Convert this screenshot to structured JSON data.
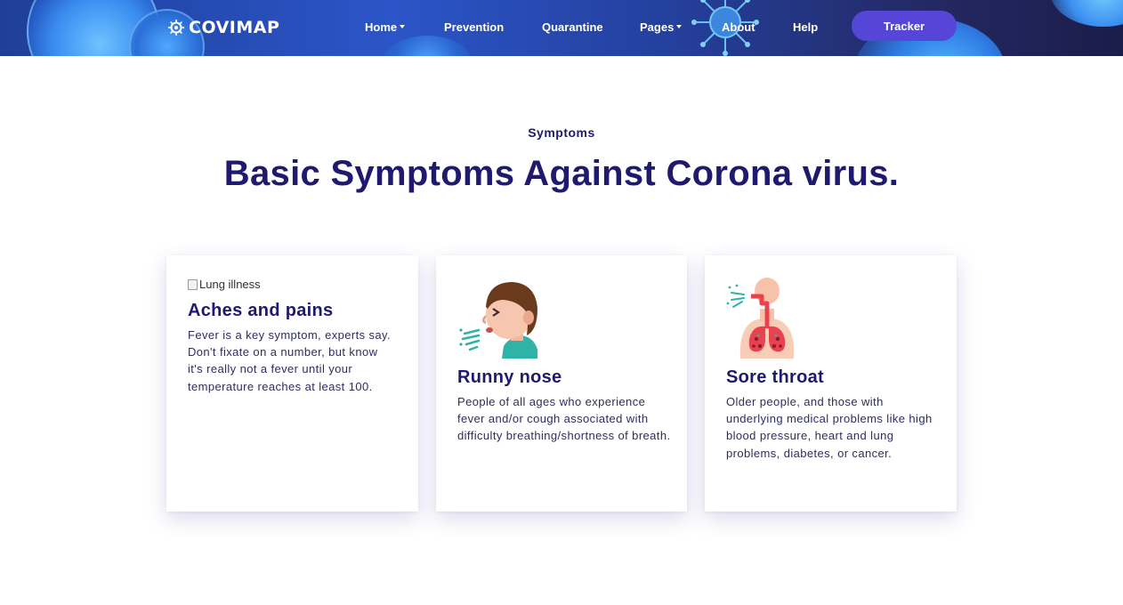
{
  "brand": {
    "name": "COVIMAP",
    "icon": "virus-logo-icon"
  },
  "nav": {
    "items": [
      {
        "label": "Home",
        "has_dropdown": true
      },
      {
        "label": "Prevention",
        "has_dropdown": false
      },
      {
        "label": "Quarantine",
        "has_dropdown": false
      },
      {
        "label": "Pages",
        "has_dropdown": true
      },
      {
        "label": "About",
        "has_dropdown": false
      },
      {
        "label": "Help",
        "has_dropdown": false
      }
    ],
    "cta_label": "Tracker"
  },
  "section": {
    "eyebrow": "Symptoms",
    "title": "Basic Symptoms Against Corona virus."
  },
  "cards": [
    {
      "image_alt": "Lung illness",
      "title": "Aches and pains",
      "text": "Fever is a key symptom, experts say. Don't fixate on a number, but know it's really not a fever until your temperature reaches at least 100."
    },
    {
      "icon": "sneezing-person-icon",
      "title": "Runny nose",
      "text": "People of all ages who experience fever and/or cough associated with difficulty breathing/shortness of breath."
    },
    {
      "icon": "lungs-throat-icon",
      "title": "Sore throat",
      "text": "Older people, and those with underlying medical problems like high blood pressure, heart and lung problems, diabetes, or cancer."
    }
  ],
  "colors": {
    "heading": "#1f1a6e",
    "cta": "#5546d8",
    "nav_bg": "#2b55c8"
  }
}
